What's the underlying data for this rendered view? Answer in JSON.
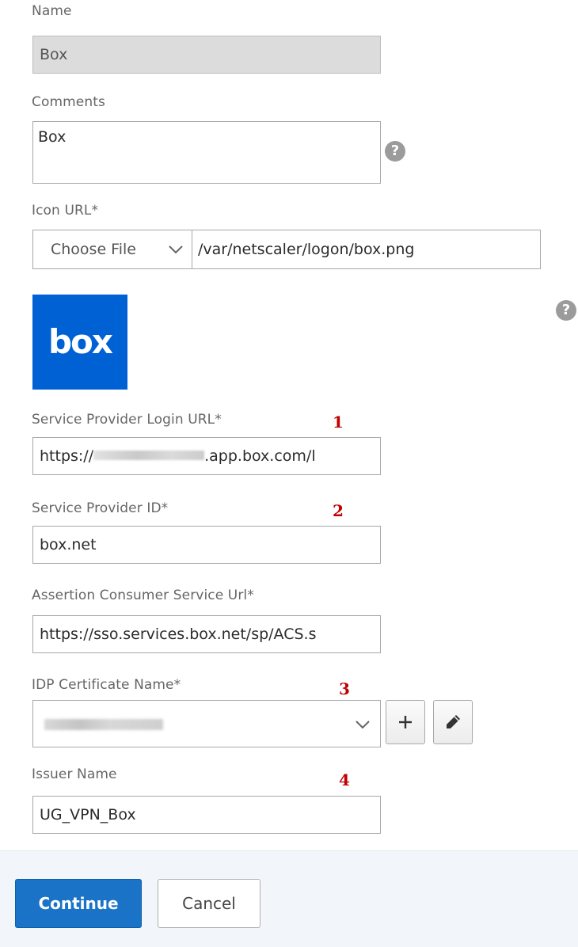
{
  "form": {
    "name": {
      "label": "Name",
      "value": "Box"
    },
    "comments": {
      "label": "Comments",
      "value": "Box"
    },
    "icon_url": {
      "label": "Icon URL*",
      "source": "Choose File",
      "path": "/var/netscaler/logon/box.png"
    },
    "logo_text": "box",
    "sp_login_url": {
      "label": "Service Provider Login URL*",
      "value_prefix": "https://",
      "value_suffix": ".app.box.com/l",
      "marker": "1"
    },
    "sp_id": {
      "label": "Service Provider ID*",
      "value": "box.net",
      "marker": "2"
    },
    "acs_url": {
      "label": "Assertion Consumer Service Url*",
      "value": "https://sso.services.box.net/sp/ACS.s"
    },
    "idp_cert": {
      "label": "IDP Certificate Name*",
      "marker": "3",
      "add": "+"
    },
    "issuer": {
      "label": "Issuer Name",
      "value": "UG_VPN_Box",
      "marker": "4"
    },
    "help_glyph": "?"
  },
  "footer": {
    "continue_label": "Continue",
    "cancel_label": "Cancel"
  },
  "colors": {
    "primary": "#1a73c6",
    "marker": "#c00000",
    "logo_bg": "#0061d5"
  }
}
